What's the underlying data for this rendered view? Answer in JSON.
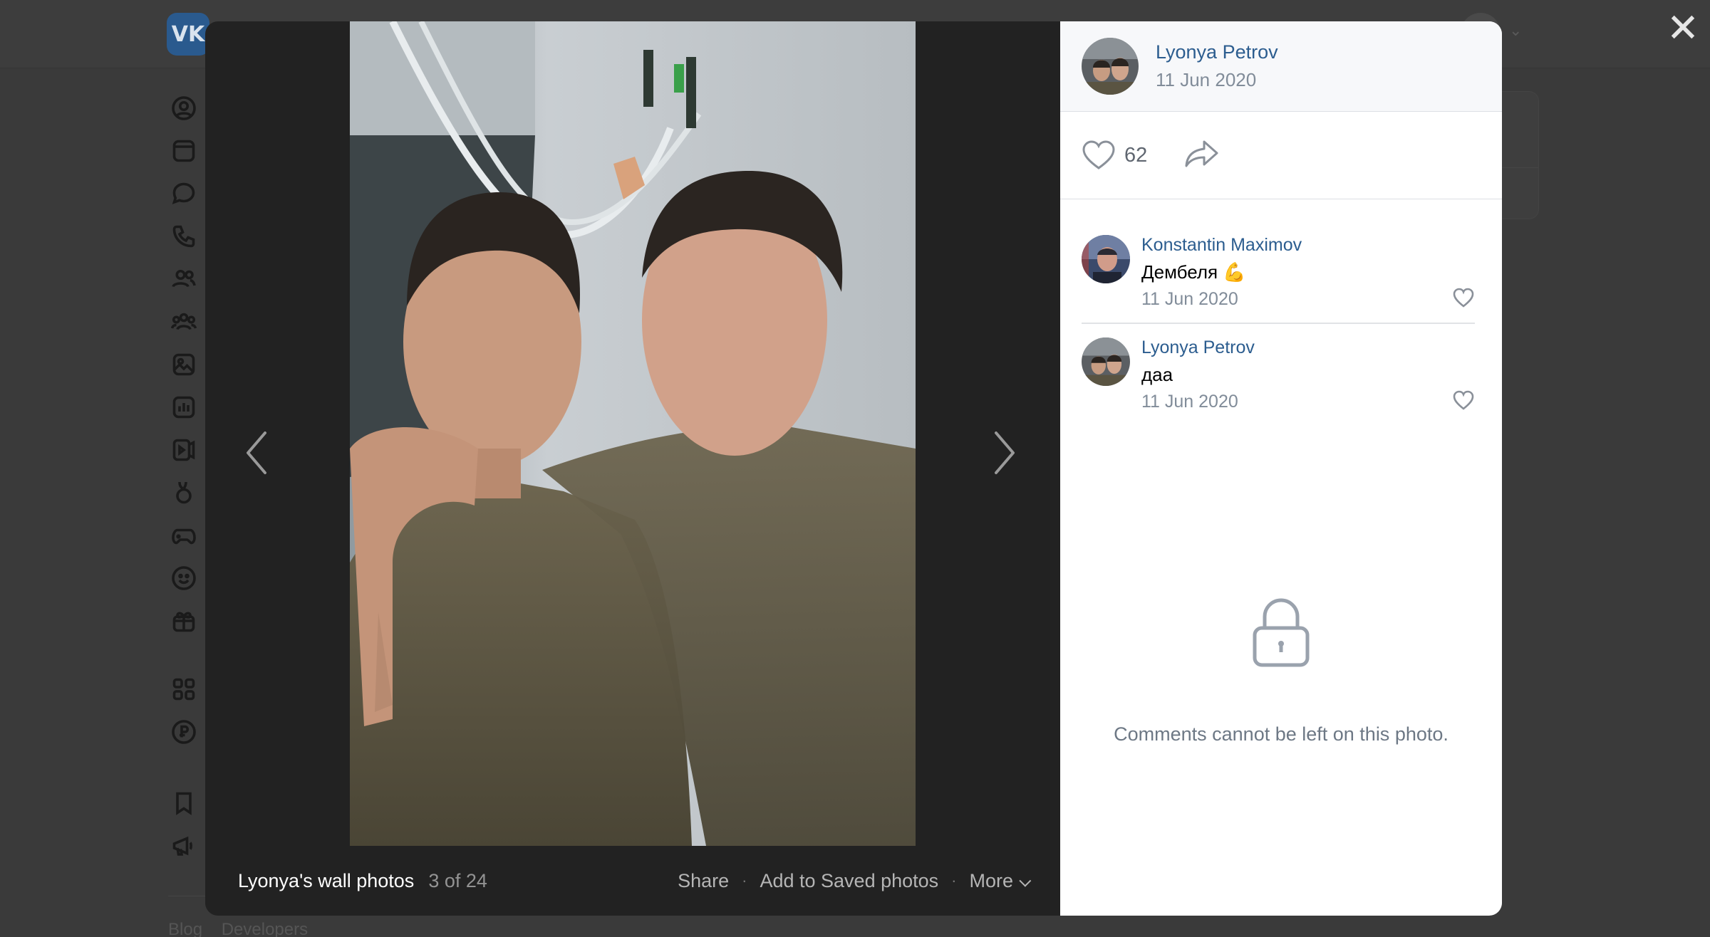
{
  "background": {
    "logo": "VK",
    "sidebar_icons": [
      "profile-icon",
      "news-icon",
      "messages-icon",
      "calls-icon",
      "friends-icon",
      "communities-icon",
      "photos-icon",
      "music-icon",
      "video-icon",
      "clips-icon",
      "games-icon",
      "stickers-icon",
      "gifts-icon",
      "services-icon",
      "payments-icon",
      "bookmarks-icon",
      "ads-icon"
    ],
    "footer": {
      "blog": "Blog",
      "developers": "Developers"
    }
  },
  "viewer": {
    "album_title": "Lyonya's wall photos",
    "counter": "3 of 24",
    "actions": {
      "share": "Share",
      "save": "Add to Saved photos",
      "more": "More"
    }
  },
  "post": {
    "author_name": "Lyonya Petrov",
    "date": "11 Jun 2020",
    "likes": "62"
  },
  "comments": [
    {
      "author": "Konstantin Maximov",
      "text": "Дембеля 💪",
      "date": "11 Jun 2020"
    },
    {
      "author": "Lyonya Petrov",
      "text": "даа",
      "date": "11 Jun 2020"
    }
  ],
  "comments_closed_text": "Comments cannot be left on this photo.",
  "colors": {
    "link": "#2c5d8f",
    "secondary": "#818c99",
    "overlay": "#222222"
  }
}
